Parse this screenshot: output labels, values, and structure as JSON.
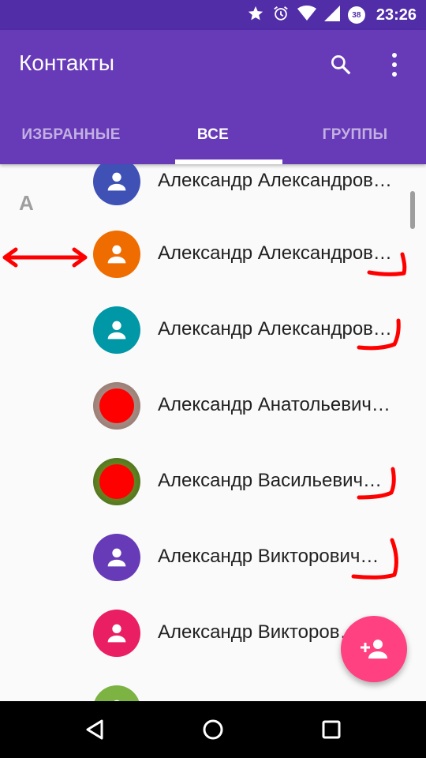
{
  "status_bar": {
    "time": "23:26",
    "battery_level": "38",
    "icons": [
      "star-icon",
      "alarm-icon",
      "wifi-icon",
      "signal-icon",
      "battery-icon"
    ]
  },
  "app_bar": {
    "title": "Контакты",
    "color": "#673ab7",
    "status_color": "#512da8",
    "actions": [
      "search-icon",
      "more-vert-icon"
    ]
  },
  "tabs": [
    {
      "label": "ИЗБРАННЫЕ",
      "active": false
    },
    {
      "label": "ВСЕ",
      "active": true
    },
    {
      "label": "ГРУППЫ",
      "active": false
    }
  ],
  "list": {
    "section_letter": "А",
    "contacts": [
      {
        "name": "Александр Александров…",
        "avatar_color": "#3f51b5",
        "avatar": "person-icon"
      },
      {
        "name": "Александр Александров…",
        "avatar_color": "#ef6c00",
        "avatar": "person-icon"
      },
      {
        "name": "Александр Александров…",
        "avatar_color": "#0097a7",
        "avatar": "person-icon"
      },
      {
        "name": "Александр Анатольевич…",
        "avatar_color": "#8d6e63",
        "avatar": "photo"
      },
      {
        "name": "Александр Васильевич…",
        "avatar_color": "#6d7a3a",
        "avatar": "photo"
      },
      {
        "name": "Александр Викторович…",
        "avatar_color": "#673ab7",
        "avatar": "person-icon"
      },
      {
        "name": "Александр Викторов…",
        "avatar_color": "#e91e63",
        "avatar": "person-icon"
      },
      {
        "name": "",
        "avatar_color": "#7cb342",
        "avatar": "person-icon"
      }
    ]
  },
  "fab": {
    "icon": "add-person-icon",
    "color": "#ff4081"
  },
  "nav_bar": {
    "buttons": [
      "back-icon",
      "home-icon",
      "recents-icon"
    ]
  },
  "annotations": {
    "color": "#ff0000"
  }
}
